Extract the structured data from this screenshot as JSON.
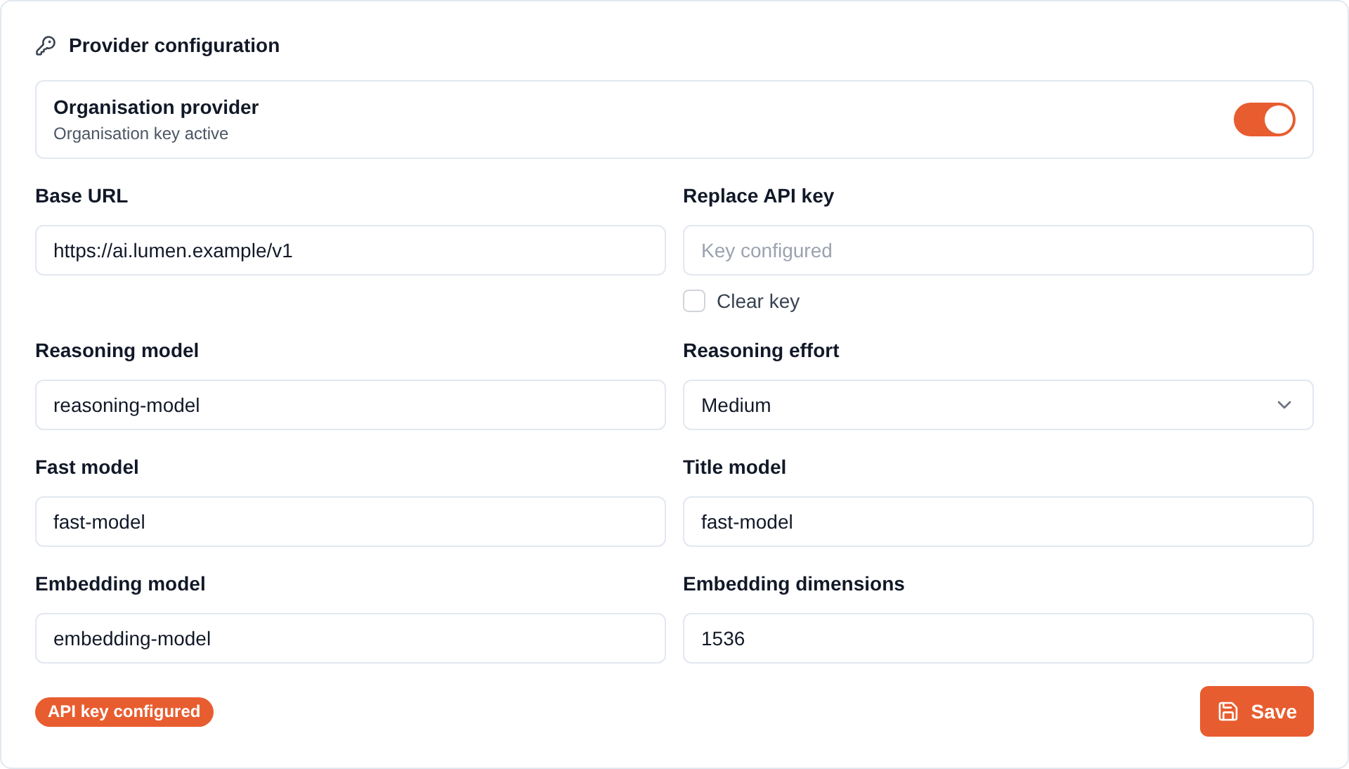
{
  "title": "Provider configuration",
  "provider": {
    "name": "Organisation provider",
    "status": "Organisation key active",
    "on": true
  },
  "fields": [
    {
      "kind": "text",
      "label": "Base URL",
      "value": "https://ai.lumen.example/v1"
    },
    {
      "kind": "text",
      "label": "Replace API key",
      "placeholder": "Key configured",
      "checkbox": {
        "label": "Clear key",
        "checked": false
      }
    },
    {
      "kind": "text",
      "label": "Reasoning model",
      "value": "reasoning-model"
    },
    {
      "kind": "select",
      "label": "Reasoning effort",
      "value": "Medium"
    },
    {
      "kind": "text",
      "label": "Fast model",
      "value": "fast-model"
    },
    {
      "kind": "text",
      "label": "Title model",
      "value": "fast-model"
    },
    {
      "kind": "text",
      "label": "Embedding model",
      "value": "embedding-model"
    },
    {
      "kind": "text",
      "label": "Embedding dimensions",
      "value": "1536"
    }
  ],
  "badge": "API key configured",
  "save_button": "Save"
}
